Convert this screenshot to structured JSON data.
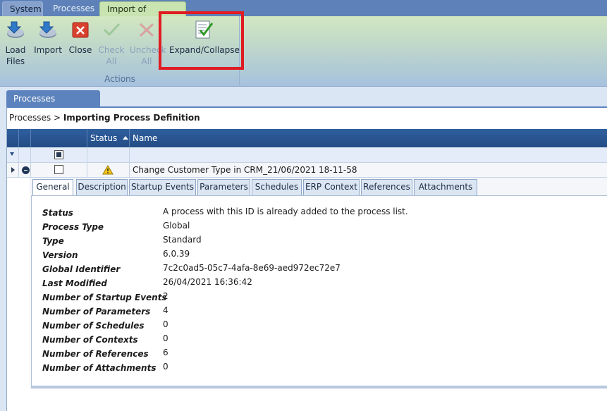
{
  "tabs": [
    {
      "label": "System"
    },
    {
      "label": "Processes"
    },
    {
      "label": "Import of Processes"
    }
  ],
  "ribbon": {
    "buttons": [
      {
        "line1": "Load",
        "line2": "Files"
      },
      {
        "line1": "Import",
        "line2": ""
      },
      {
        "line1": "Close",
        "line2": ""
      },
      {
        "line1": "Check",
        "line2": "All"
      },
      {
        "line1": "Uncheck",
        "line2": "All"
      },
      {
        "line1": "Expand/Collapse",
        "line2": ""
      }
    ],
    "group_label": "Actions"
  },
  "document_tab": "Processes",
  "breadcrumb": {
    "parent": "Processes",
    "separator": " > ",
    "current": "Importing Process Definition"
  },
  "grid": {
    "columns": {
      "status": "Status",
      "name": "Name"
    },
    "row": {
      "name": "Change Customer Type in CRM_21/06/2021 18-11-58",
      "status_icon": "warning-icon"
    }
  },
  "detail_tabs": [
    {
      "label": "General"
    },
    {
      "label": "Description"
    },
    {
      "label": "Startup Events"
    },
    {
      "label": "Parameters"
    },
    {
      "label": "Schedules"
    },
    {
      "label": "ERP Context"
    },
    {
      "label": "References"
    },
    {
      "label": "Attachments"
    }
  ],
  "properties": [
    {
      "label": "Status",
      "value": "A process with this ID is already added to the process list."
    },
    {
      "label": "Process Type",
      "value": "Global"
    },
    {
      "label": "Type",
      "value": "Standard"
    },
    {
      "label": "Version",
      "value": "6.0.39"
    },
    {
      "label": "Global Identifier",
      "value": "7c2c0ad5-05c7-4afa-8e69-aed972ec72e7"
    },
    {
      "label": "Last Modified",
      "value": "26/04/2021 16:36:42"
    },
    {
      "label": "Number of Startup Events",
      "value": "2"
    },
    {
      "label": "Number of Parameters",
      "value": "4"
    },
    {
      "label": "Number of Schedules",
      "value": "0"
    },
    {
      "label": "Number of Contexts",
      "value": "0"
    },
    {
      "label": "Number of References",
      "value": "6"
    },
    {
      "label": "Number of Attachments",
      "value": "0"
    }
  ],
  "colors": {
    "highlight": "#e01b22",
    "header": "#2f5f9e",
    "accent_tab": "#c9e3b1"
  }
}
